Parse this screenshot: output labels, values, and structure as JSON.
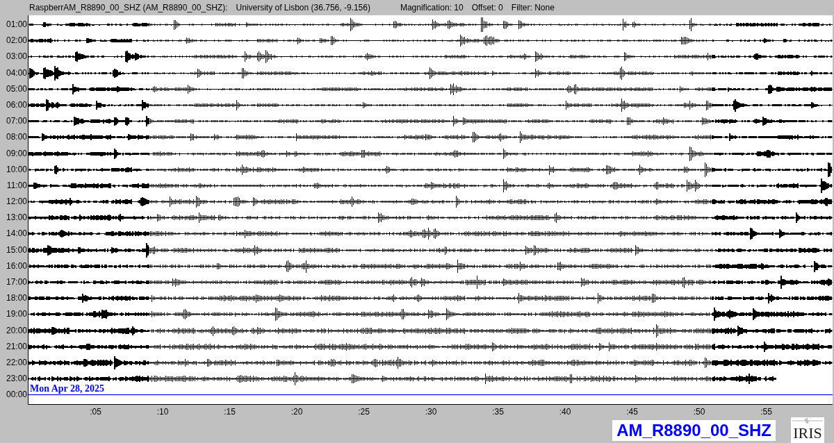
{
  "header": {
    "station": "RaspberrAM_R8890_00_SHZ (AM_R8890_00_SHZ):",
    "location": "University of Lisbon (36.756, -9.156)",
    "magnification": "Magnification: 10",
    "offset": "Offset: 0",
    "filter": "Filter: None"
  },
  "rows": [
    {
      "label": "01:00",
      "kind": "trace"
    },
    {
      "label": "02:00",
      "kind": "trace"
    },
    {
      "label": "03:00",
      "kind": "trace"
    },
    {
      "label": "04:00",
      "kind": "trace"
    },
    {
      "label": "05:00",
      "kind": "trace"
    },
    {
      "label": "06:00",
      "kind": "trace"
    },
    {
      "label": "07:00",
      "kind": "trace"
    },
    {
      "label": "08:00",
      "kind": "trace"
    },
    {
      "label": "09:00",
      "kind": "trace"
    },
    {
      "label": "10:00",
      "kind": "trace"
    },
    {
      "label": "11:00",
      "kind": "trace"
    },
    {
      "label": "12:00",
      "kind": "trace"
    },
    {
      "label": "13:00",
      "kind": "trace"
    },
    {
      "label": "14:00",
      "kind": "trace"
    },
    {
      "label": "15:00",
      "kind": "trace"
    },
    {
      "label": "16:00",
      "kind": "trace"
    },
    {
      "label": "17:00",
      "kind": "trace"
    },
    {
      "label": "18:00",
      "kind": "trace"
    },
    {
      "label": "19:00",
      "kind": "trace"
    },
    {
      "label": "20:00",
      "kind": "trace"
    },
    {
      "label": "21:00",
      "kind": "trace"
    },
    {
      "label": "22:00",
      "kind": "trace"
    },
    {
      "label": "23:00",
      "kind": "partial"
    },
    {
      "label": "00:00",
      "kind": "current"
    }
  ],
  "date": "Mon Apr 28, 2025",
  "x_ticks": [
    ":05",
    ":10",
    ":15",
    ":20",
    ":25",
    ":30",
    ":35",
    ":40",
    ":45",
    ":50",
    ":55"
  ],
  "station_label": "AM_R8890_00_SHZ",
  "logo": "IRIS"
}
